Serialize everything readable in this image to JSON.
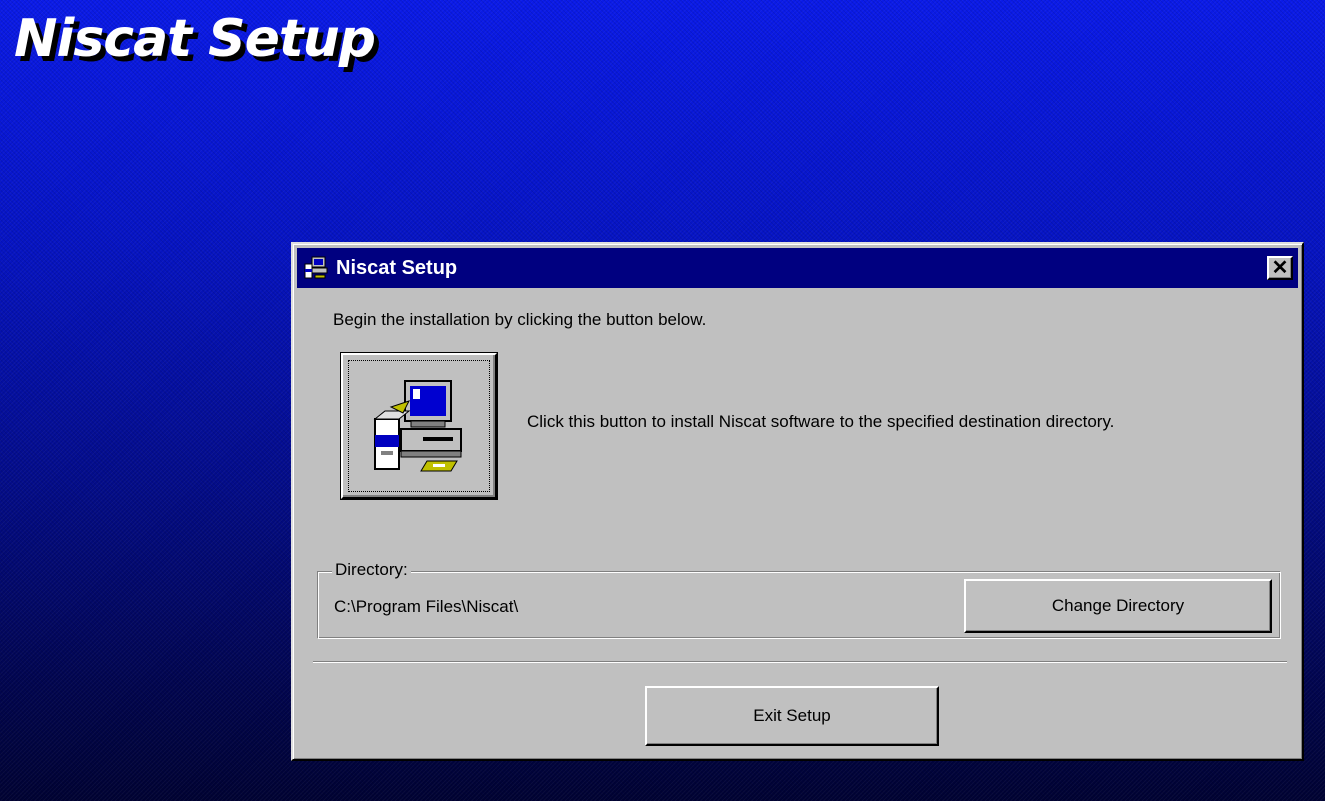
{
  "background": {
    "title": "Niscat Setup",
    "gradient_top": "#0a1ae8",
    "gradient_bottom": "#000233"
  },
  "dialog": {
    "title": "Niscat Setup",
    "close_glyph": "✕",
    "titlebar_color": "#000080",
    "body_color": "#c0c0c0",
    "instruction": "Begin the installation by clicking the button below.",
    "install_button": {
      "icon": "setup-computer-icon",
      "description": "Click this button to install Niscat software to the specified destination directory."
    },
    "directory": {
      "label": "Directory:",
      "path": "C:\\Program Files\\Niscat\\",
      "change_button": "Change Directory"
    },
    "exit_button": "Exit Setup"
  }
}
